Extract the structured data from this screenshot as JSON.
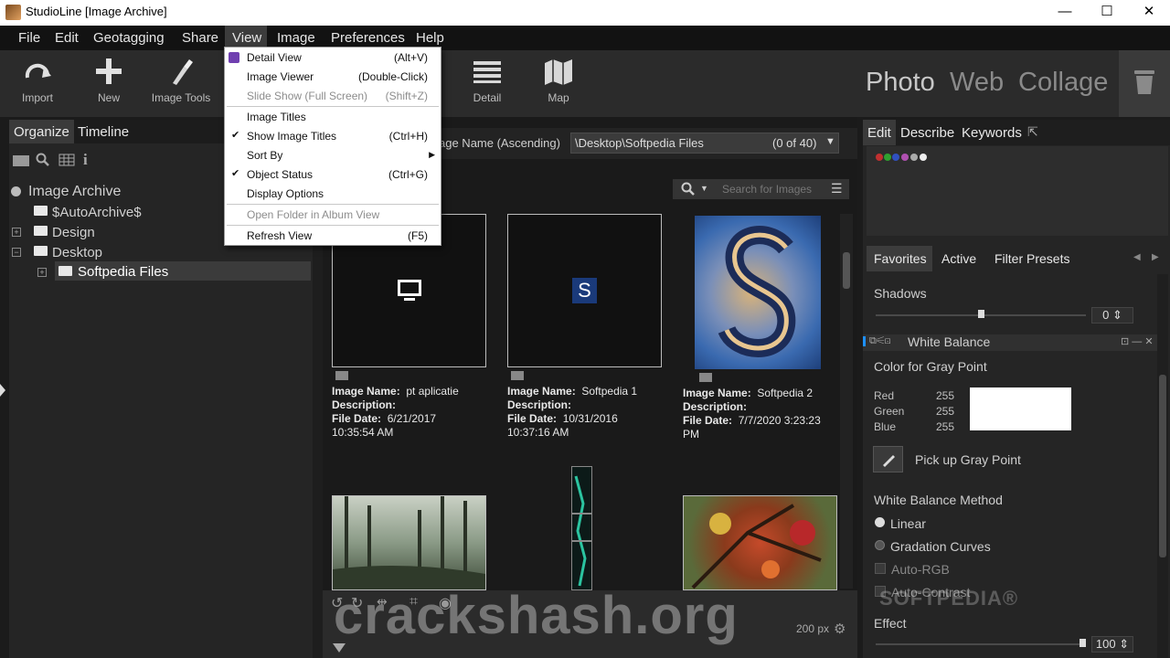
{
  "window": {
    "title": "StudioLine [Image Archive]",
    "minimize": "—",
    "maximize": "☐",
    "close": "✕"
  },
  "menubar": [
    "File",
    "Edit",
    "Geotagging",
    "Share",
    "View",
    "Image",
    "Preferences",
    "Help"
  ],
  "toolbar": {
    "import": "Import",
    "new": "New",
    "image_tools": "Image Tools",
    "detail": "Detail",
    "map": "Map"
  },
  "modes": [
    "Photo",
    "Web",
    "Collage"
  ],
  "left": {
    "tabs": [
      "Organize",
      "Timeline"
    ],
    "tree": {
      "root": "Image Archive",
      "items": [
        "$AutoArchive$",
        "Design",
        "Desktop",
        "Softpedia Files"
      ]
    }
  },
  "center": {
    "sort": "age Name (Ascending)",
    "path": "\\Desktop\\Softpedia Files",
    "count": "(0 of 40)",
    "search_placeholder": "Search for Images",
    "thumb_s_letter": "S",
    "labels": {
      "name": "Image Name:",
      "desc": "Description:",
      "date": "File Date:"
    },
    "items": [
      {
        "name": "pt aplicatie",
        "date1": "6/21/2017",
        "date2": "10:35:54 AM"
      },
      {
        "name": "Softpedia 1",
        "date1": "10/31/2016",
        "date2": "10:37:16 AM"
      },
      {
        "name": "Softpedia 2",
        "date1": "7/7/2020 3:23:23",
        "date2": "PM"
      }
    ],
    "thumb_size": "200 px"
  },
  "view_menu": [
    {
      "label": "Detail View",
      "shortcut": "(Alt+V)",
      "enabled": true
    },
    {
      "label": "Image Viewer",
      "shortcut": "(Double-Click)",
      "enabled": true
    },
    {
      "label": "Slide Show (Full Screen)",
      "shortcut": "(Shift+Z)",
      "enabled": false
    },
    {
      "label": "Image Titles",
      "shortcut": "",
      "enabled": true
    },
    {
      "label": "Show Image Titles",
      "shortcut": "(Ctrl+H)",
      "enabled": true
    },
    {
      "label": "Sort By",
      "shortcut": "",
      "enabled": true
    },
    {
      "label": "Object Status",
      "shortcut": "(Ctrl+G)",
      "enabled": true
    },
    {
      "label": "Display Options",
      "shortcut": "",
      "enabled": true
    },
    {
      "label": "Open Folder in Album View",
      "shortcut": "",
      "enabled": false
    },
    {
      "label": "Refresh View",
      "shortcut": "(F5)",
      "enabled": true
    }
  ],
  "right": {
    "tabs": [
      "Edit",
      "Describe",
      "Keywords"
    ],
    "subtabs": [
      "Favorites",
      "Active",
      "Filter Presets"
    ],
    "shadows_label": "Shadows",
    "shadows_value": "0",
    "wb_title": "White Balance",
    "gray_point_label": "Color for Gray Point",
    "rgb": [
      {
        "label": "Red",
        "value": "255"
      },
      {
        "label": "Green",
        "value": "255"
      },
      {
        "label": "Blue",
        "value": "255"
      }
    ],
    "pick_label": "Pick up Gray Point",
    "method_label": "White Balance Method",
    "methods": [
      "Linear",
      "Gradation Curves"
    ],
    "checks": [
      "Auto-RGB",
      "Auto-Contrast"
    ],
    "effect_label": "Effect",
    "effect_value": "100"
  },
  "watermark": "crackshash.org",
  "softpedia_mark": "SOFTPEDIA®"
}
